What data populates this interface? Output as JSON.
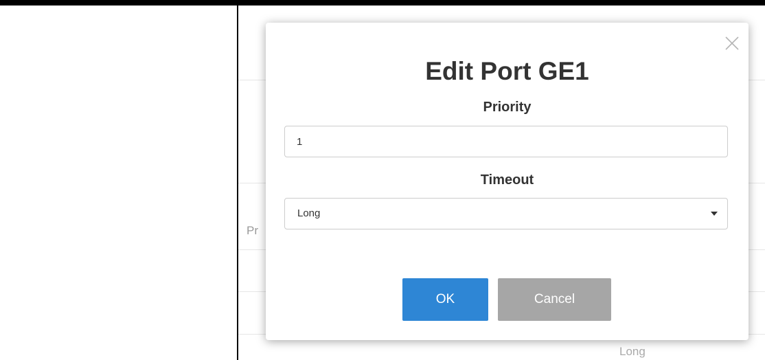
{
  "background": {
    "fragment_left": "Pr",
    "fragment_bottom": "Long"
  },
  "dialog": {
    "title": "Edit Port GE1",
    "close_icon": "close-icon",
    "priority": {
      "label": "Priority",
      "value": "1"
    },
    "timeout": {
      "label": "Timeout",
      "selected": "Long",
      "caret_icon": "caret-down-icon"
    },
    "buttons": {
      "ok": "OK",
      "cancel": "Cancel"
    }
  },
  "colors": {
    "ok_button": "#2e86d5",
    "cancel_button": "#a6a6a6",
    "title_text": "#333333",
    "input_border": "#cccccc"
  }
}
